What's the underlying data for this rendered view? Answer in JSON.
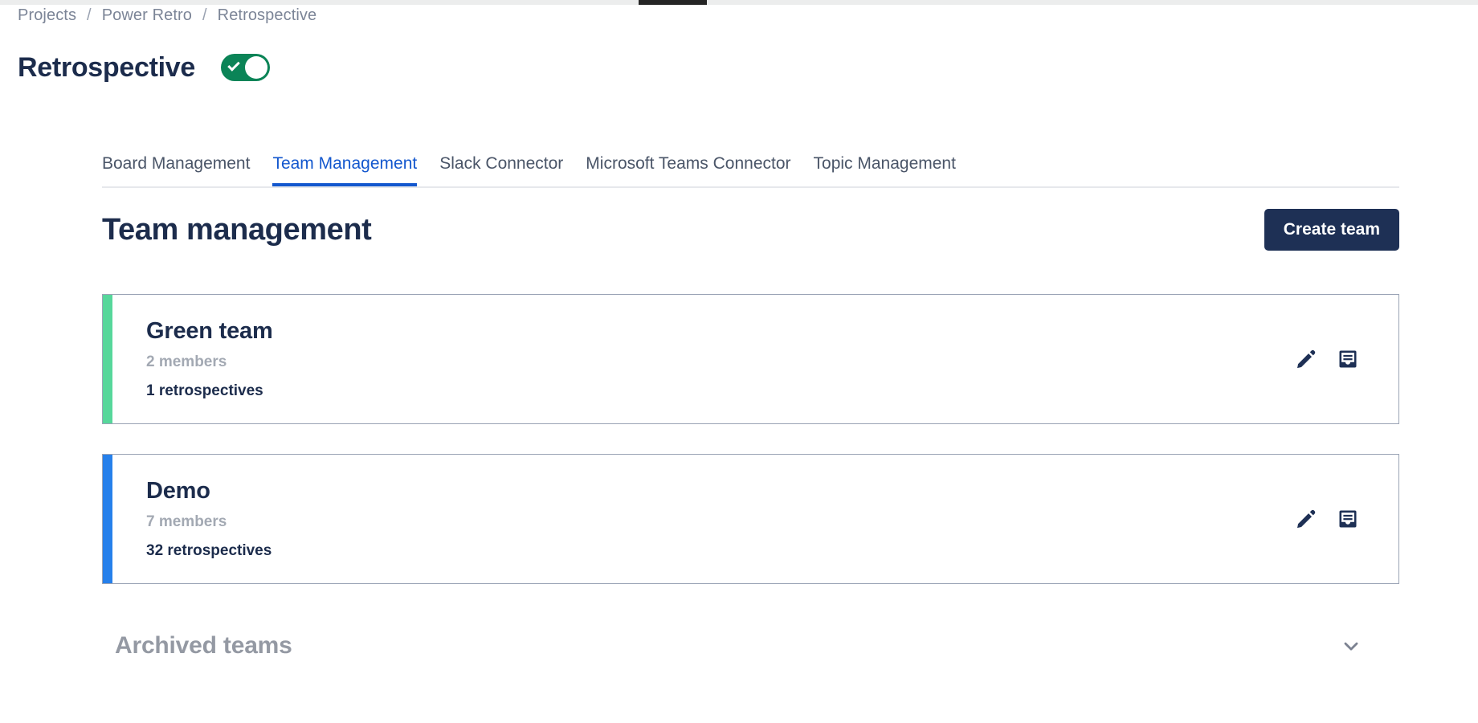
{
  "browser": {
    "active_tab_indicator": ""
  },
  "breadcrumb": {
    "items": [
      {
        "label": "Projects"
      },
      {
        "label": "Power Retro"
      },
      {
        "label": "Retrospective"
      }
    ],
    "separator": "/"
  },
  "header": {
    "title": "Retrospective",
    "toggle": {
      "state": "on",
      "icon": "check-icon",
      "on_color": "#0b8457"
    }
  },
  "tabs": [
    {
      "label": "Board Management",
      "active": false
    },
    {
      "label": "Team Management",
      "active": true
    },
    {
      "label": "Slack Connector",
      "active": false
    },
    {
      "label": "Microsoft Teams Connector",
      "active": false
    },
    {
      "label": "Topic Management",
      "active": false
    }
  ],
  "main": {
    "section_title": "Team management",
    "create_button": "Create team",
    "teams": [
      {
        "name": "Green team",
        "members": "2 members",
        "retrospectives": "1 retrospectives",
        "accent_color": "#57d79b",
        "edit_icon": "pencil-icon",
        "archive_icon": "archive-icon"
      },
      {
        "name": "Demo",
        "members": "7 members",
        "retrospectives": "32 retrospectives",
        "accent_color": "#2680eb",
        "edit_icon": "pencil-icon",
        "archive_icon": "archive-icon"
      }
    ],
    "archived": {
      "title": "Archived teams",
      "chevron_icon": "chevron-down-icon",
      "expanded": false
    }
  },
  "colors": {
    "title_navy": "#1c2c4c",
    "tab_active_blue": "#1357ce",
    "button_navy": "#1e3055",
    "muted_gray": "#a3a9b3"
  }
}
